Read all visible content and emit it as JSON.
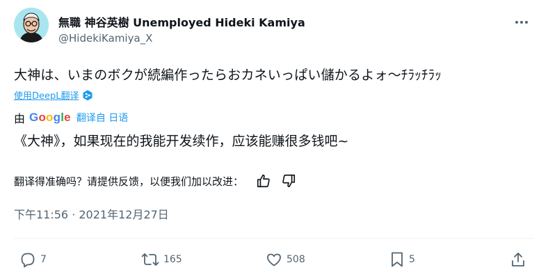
{
  "author": {
    "display_name": "無職 神谷英樹 Unemployed Hideki Kamiya",
    "handle": "@HidekiKamiya_X"
  },
  "tweet": {
    "text": "大神は、いまのボクが続編作ったらおカネいっぱい儲かるよォ〜ﾁﾗｯﾁﾗｯ",
    "deepl_link": "使用DeepL翻译",
    "translated_by_prefix": "由",
    "google_logo_text": "Google",
    "translated_from": "翻译自 日语",
    "translated_text": "《大神》，如果现在的我能开发续作，应该能赚很多钱吧~",
    "feedback_prompt": "翻译得准确吗？请提供反馈，以便我们加以改进：",
    "timestamp": "下午11:56 · 2021年12月27日"
  },
  "actions": {
    "reply_count": "7",
    "retweet_count": "165",
    "like_count": "508",
    "bookmark_count": "5"
  },
  "colors": {
    "accent": "#1d9bf0",
    "text_primary": "#0f1419",
    "text_secondary": "#536471",
    "avatar_bg": "#a8e6ef"
  },
  "icons": [
    "avatar",
    "more-icon",
    "deepl-icon",
    "thumbs-up-icon",
    "thumbs-down-icon",
    "reply-icon",
    "retweet-icon",
    "like-icon",
    "bookmark-icon",
    "share-icon"
  ]
}
